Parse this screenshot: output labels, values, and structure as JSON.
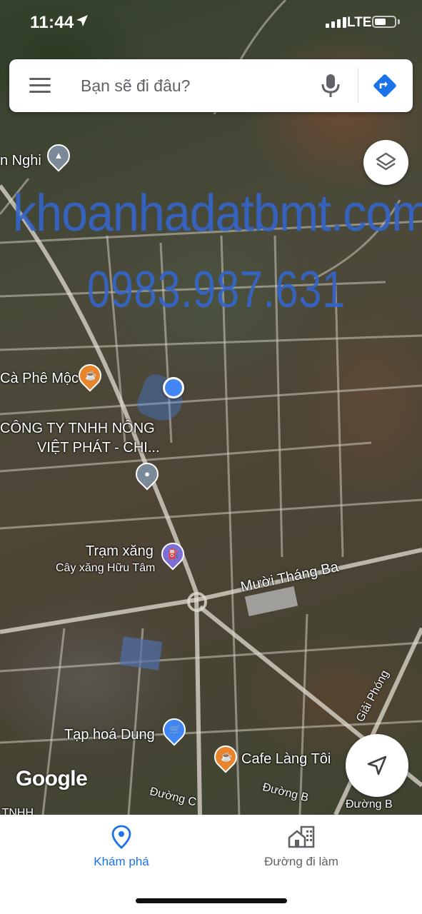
{
  "status_bar": {
    "time": "11:44",
    "network": "LTE",
    "battery_level": 0.5
  },
  "search": {
    "placeholder": "Bạn sẽ đi đâu?"
  },
  "watermark": {
    "site": "khoanhadatbmt.com",
    "phone": "0983.987.631"
  },
  "map": {
    "labels": {
      "school": "n Nghi",
      "cafe_moc": "Cà Phê Mộc",
      "company_line1": "CÔNG TY TNHH NÔNG",
      "company_line2": "VIỆT PHÁT - CHI...",
      "gas_station": "Trạm xăng",
      "gas_station_name": "Cây xăng Hữu Tâm",
      "street_muoi_thang_ba": "Mười Tháng Ba",
      "street_giai_phong": "Giải Phóng",
      "grocery": "Tạp hoá Dung",
      "cafe_lang_toi": "Cafe Làng Tôi",
      "street_duong_c": "Đường C",
      "street_duong_b1": "Đường B",
      "street_duong_b2": "Đường B",
      "company_cut": "ty TNHH"
    },
    "attribution": "Google"
  },
  "bottom_nav": {
    "explore_label": "Khám phá",
    "commute_label": "Đường đi làm"
  },
  "colors": {
    "accent": "#1a73e8",
    "pin_orange": "#e8842c",
    "pin_blue": "#4285f4",
    "pin_grey": "#7b8a99",
    "watermark": "#3565c8"
  }
}
